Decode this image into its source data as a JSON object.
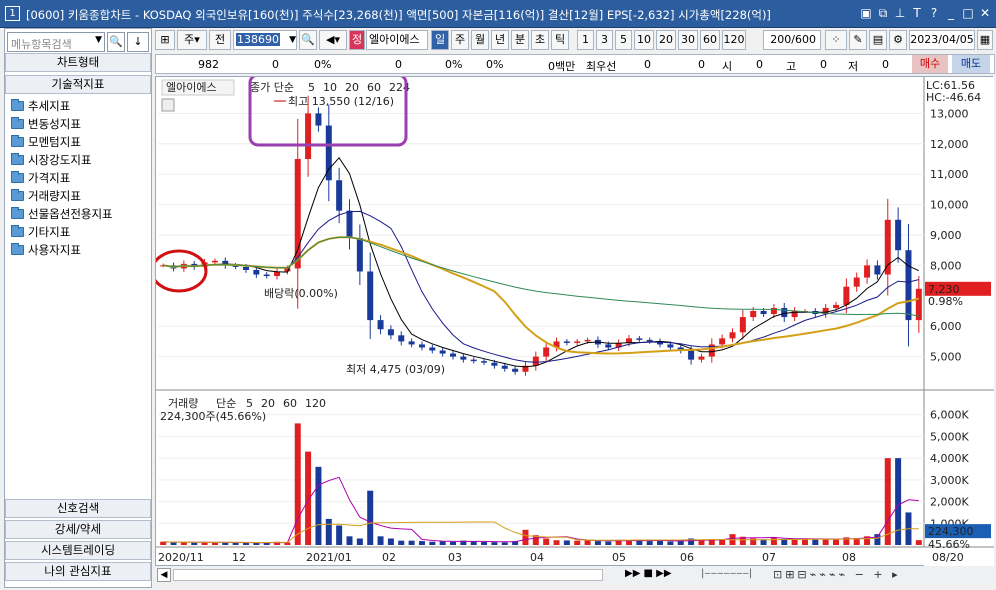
{
  "titlebar": {
    "num": "1",
    "text": "[0600] 키움종합차트 - KOSDAQ 외국인보유[160(천)] 주식수[23,268(천)] 액면[500] 자본금[116(억)] 결산[12월] EPS[-2,632] 시가총액[228(억)]"
  },
  "left": {
    "search_placeholder": "메뉴항목검색",
    "chart_type": "차트형태",
    "tech": "기술적지표",
    "tree": [
      "추세지표",
      "변동성지표",
      "모멘텀지표",
      "시장강도지표",
      "가격지표",
      "거래량지표",
      "선물옵션전용지표",
      "기타지표",
      "사용자지표"
    ],
    "bottom": [
      "신호검색",
      "강세/약세",
      "시스템트레이딩",
      "나의 관심지표"
    ]
  },
  "toolbar": {
    "ju": "주",
    "jeon": "전",
    "code": "138690",
    "jeong": "정",
    "name": "엘아이에스",
    "periods": [
      "일",
      "주",
      "월",
      "년",
      "분",
      "초",
      "틱"
    ],
    "nums": [
      "1",
      "3",
      "5",
      "10",
      "20",
      "30",
      "60",
      "120"
    ],
    "count": "200/600",
    "date": "2023/04/05",
    "info": [
      "982",
      "0",
      "0%",
      "0",
      "0%",
      "0%",
      "0백만",
      "최우선",
      "0",
      "0",
      "시",
      "0",
      "고",
      "0",
      "저",
      "0"
    ],
    "buy": "매수",
    "sell": "매도"
  },
  "chart": {
    "stock_name": "엘아이에스",
    "ma_title": "종가 단순",
    "ma_periods": [
      "5",
      "10",
      "20",
      "60",
      "224"
    ],
    "high_label": "최고 13,550 (12/16)",
    "low_label": "최저 4,475 (03/09)",
    "dividend_label": "배당락(0.00%)",
    "lc": "LC:61.56",
    "hc": "HC:-46.64",
    "price_ticks": [
      "13,000",
      "12,000",
      "11,000",
      "10,000",
      "9,000",
      "8,000",
      "6,000",
      "5,000"
    ],
    "current_price": "7,230",
    "current_pct": "0.98%",
    "vol_title": "거래량",
    "vol_ma_label": "단순",
    "vol_ma_periods": [
      "5",
      "20",
      "60",
      "120"
    ],
    "vol_value": "224,300주(45.66%)",
    "vol_ticks": [
      "6,000K",
      "5,000K",
      "4,000K",
      "3,000K",
      "2,000K",
      "1,000K"
    ],
    "vol_current": "224,300",
    "vol_pct": "45.66%",
    "x_labels": [
      "2020/11",
      "12",
      "2021/01",
      "02",
      "03",
      "04",
      "05",
      "06",
      "07",
      "08",
      "08/20"
    ]
  },
  "chart_data": {
    "type": "candlestick",
    "title": "엘아이에스",
    "ylim": [
      4000,
      14000
    ],
    "annotations": {
      "high": {
        "value": 13550,
        "date": "12/16"
      },
      "low": {
        "value": 4475,
        "date": "03/09"
      },
      "last": {
        "value": 7230,
        "change_pct": "0.98%"
      }
    },
    "closes": [
      8000,
      7900,
      8050,
      7950,
      8100,
      8150,
      8000,
      7950,
      7850,
      7700,
      7650,
      7800,
      7900,
      11500,
      13000,
      12600,
      10800,
      9800,
      8900,
      7800,
      6200,
      5900,
      5700,
      5500,
      5400,
      5300,
      5200,
      5100,
      5000,
      4900,
      4850,
      4800,
      4700,
      4600,
      4500,
      4700,
      5000,
      5300,
      5500,
      5450,
      5500,
      5550,
      5400,
      5300,
      5450,
      5600,
      5550,
      5500,
      5400,
      5300,
      5200,
      4900,
      5000,
      5400,
      5600,
      5800,
      6300,
      6500,
      6400,
      6600,
      6300,
      6500,
      6500,
      6400,
      6600,
      6700,
      7300,
      7600,
      8000,
      7700,
      9500,
      8500,
      6200,
      7230
    ],
    "volume_k": [
      150,
      120,
      140,
      110,
      130,
      100,
      120,
      110,
      100,
      90,
      100,
      150,
      120,
      5600,
      4300,
      3600,
      1200,
      900,
      400,
      300,
      2500,
      400,
      300,
      200,
      200,
      180,
      150,
      160,
      150,
      200,
      170,
      140,
      130,
      120,
      180,
      700,
      450,
      300,
      220,
      210,
      200,
      210,
      180,
      160,
      240,
      230,
      210,
      180,
      200,
      160,
      180,
      300,
      250,
      260,
      230,
      500,
      380,
      300,
      260,
      320,
      280,
      260,
      300,
      250,
      300,
      260,
      350,
      320,
      400,
      500,
      4000,
      4000,
      1500,
      224
    ]
  }
}
